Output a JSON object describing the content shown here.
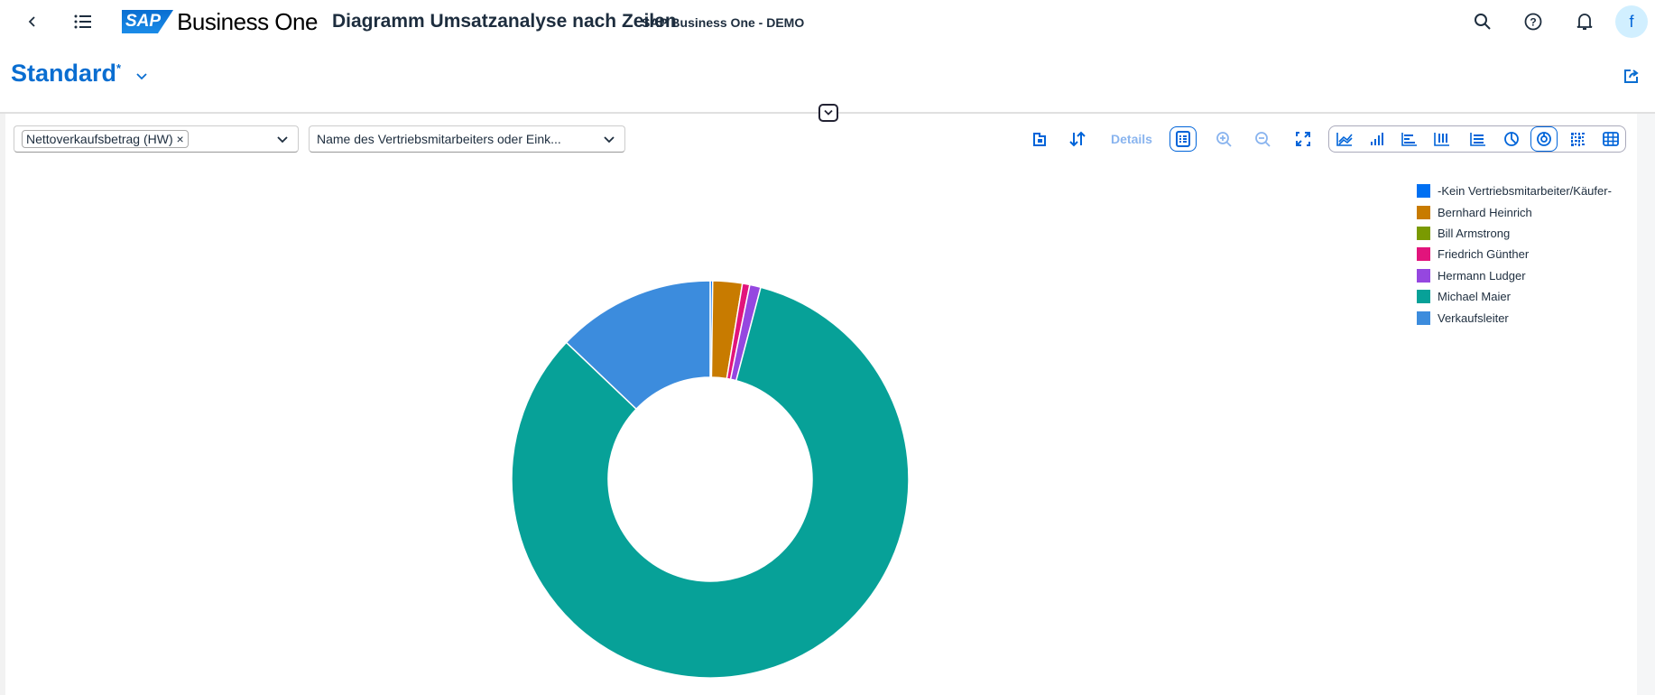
{
  "header": {
    "logo_text": "SAP",
    "product": "Business One",
    "title": "Diagramm Umsatzanalyse nach Zeilen",
    "company": "SAP Business One - DEMO",
    "avatar": "f",
    "icons": [
      "back-icon",
      "menu-list-icon",
      "search-icon",
      "help-icon",
      "bell-icon"
    ]
  },
  "variant": {
    "name": "Standard",
    "modified": "*"
  },
  "filters": {
    "measure_token": "Nettoverkaufsbetrag (HW)",
    "dimension": "Name des Vertriebsmitarbeiters oder Eink..."
  },
  "toolbar": {
    "details_label": "Details",
    "chart_types": [
      "line",
      "column",
      "bar",
      "stacked-column",
      "stacked-bar",
      "pie",
      "donut",
      "heatmap",
      "table"
    ],
    "selected_chart_type": "donut"
  },
  "colors": {
    "accent": "#0a6ed1"
  },
  "chart_data": {
    "type": "pie",
    "donut": true,
    "legend_placement": "top-right",
    "categories": [
      "-Kein Vertriebsmitarbeiter/Käufer-",
      "Bernhard Heinrich",
      "Bill Armstrong",
      "Friedrich Günther",
      "Hermann Ludger",
      "Michael Maier",
      "Verkaufsleiter"
    ],
    "values": [
      0.2,
      2.4,
      0.0,
      0.6,
      0.9,
      83.0,
      12.9
    ],
    "value_unit": "percent share (estimated)",
    "colors": [
      "#0070f2",
      "#c87b00",
      "#7a9a01",
      "#e2147c",
      "#9547e0",
      "#07a198",
      "#3c8cdd"
    ]
  }
}
